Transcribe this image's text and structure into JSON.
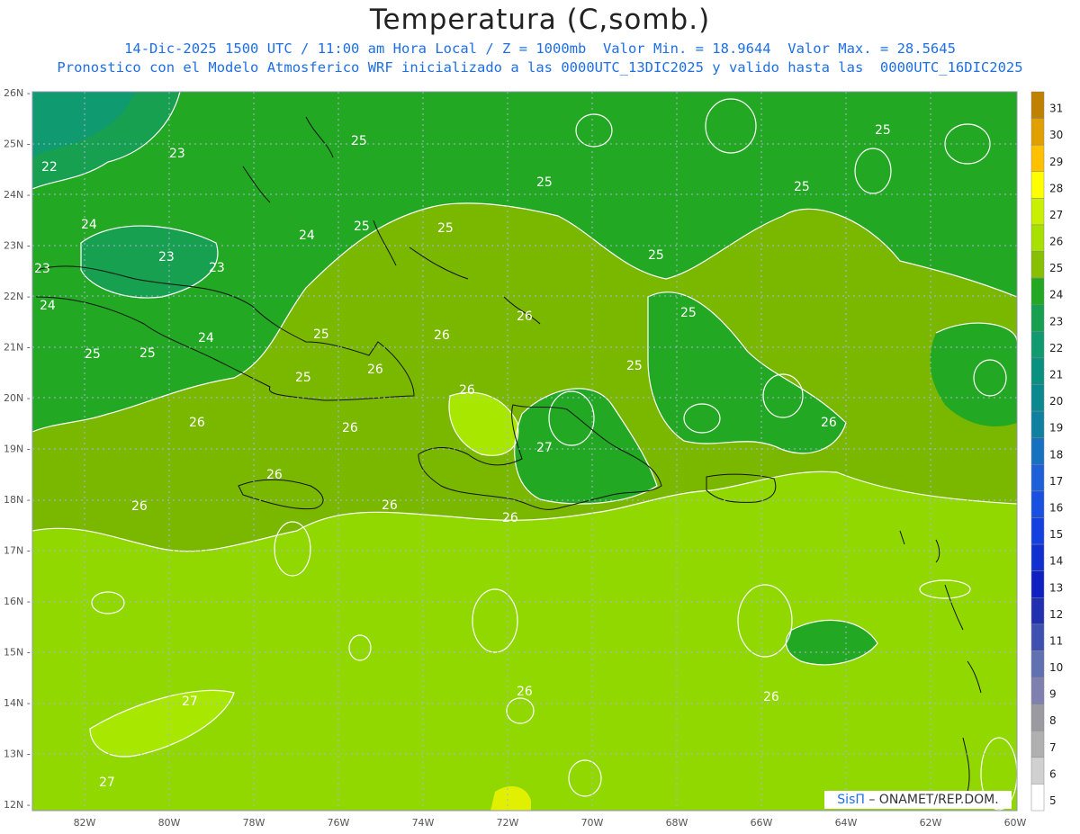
{
  "title": "Temperatura (C,somb.)",
  "subtitle1": "14-Dic-2025 1500 UTC / 11:00 am Hora Local / Z = 1000mb  Valor Min. = 18.9644  Valor Max. = 28.5645",
  "subtitle2": "Pronostico con el Modelo Atmosferico WRF inicializado a las 0000UTC_13DIC2025 y valido hasta las  0000UTC_16DIC2025",
  "lat_labels": [
    "26N",
    "25N",
    "24N",
    "23N",
    "22N",
    "21N",
    "20N",
    "19N",
    "18N",
    "17N",
    "16N",
    "15N",
    "14N",
    "13N",
    "12N"
  ],
  "lon_labels": [
    "82W",
    "80W",
    "78W",
    "76W",
    "74W",
    "72W",
    "70W",
    "68W",
    "66W",
    "64W",
    "62W",
    "60W"
  ],
  "colorbar": {
    "levels": [
      "31",
      "30",
      "29",
      "28",
      "27",
      "26",
      "25",
      "24",
      "23",
      "22",
      "21",
      "20",
      "19",
      "18",
      "17",
      "16",
      "15",
      "14",
      "13",
      "12",
      "11",
      "10",
      "9",
      "8",
      "7",
      "6",
      "5"
    ],
    "colors": [
      "#c08000",
      "#e0a000",
      "#ffc000",
      "#ffff00",
      "#c8f000",
      "#a8e000",
      "#88c000",
      "#22a822",
      "#16a050",
      "#0f9a70",
      "#0a9080",
      "#0a8890",
      "#1080a0",
      "#1870c0",
      "#1e60d8",
      "#1a50e0",
      "#1440e0",
      "#1030d0",
      "#1020c0",
      "#2030b0",
      "#4050b0",
      "#6070b0",
      "#8080b0",
      "#9a9aa0",
      "#b0b0b0",
      "#d0d0d0",
      "#ffffff"
    ]
  },
  "contour_labels": [
    "22",
    "23",
    "23",
    "23",
    "24",
    "24",
    "24",
    "24",
    "23",
    "25",
    "25",
    "25",
    "25",
    "25",
    "25",
    "25",
    "25",
    "25",
    "25",
    "25",
    "25",
    "25",
    "26",
    "26",
    "26",
    "26",
    "26",
    "26",
    "26",
    "26",
    "26",
    "26",
    "26",
    "26",
    "26",
    "27",
    "27",
    "27"
  ],
  "credit_brand": "SisΠ",
  "credit_text": " – ONAMET/REP.DOM."
}
